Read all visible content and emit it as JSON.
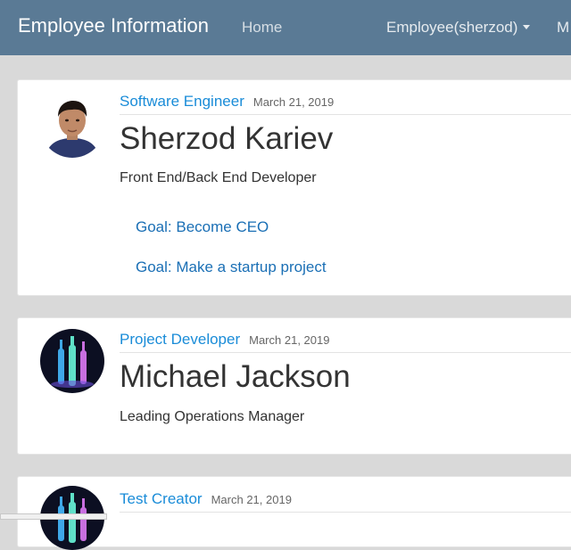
{
  "navbar": {
    "brand": "Employee Information",
    "home": "Home",
    "user_menu": "Employee(sherzod)",
    "more": "M"
  },
  "employees": [
    {
      "role": "Software Engineer",
      "date": "March 21, 2019",
      "name": "Sherzod Kariev",
      "title": "Front End/Back End Developer",
      "goals": [
        "Goal: Become CEO",
        "Goal: Make a startup project"
      ]
    },
    {
      "role": "Project Developer",
      "date": "March 21, 2019",
      "name": "Michael Jackson",
      "title": "Leading Operations Manager",
      "goals": []
    },
    {
      "role": "Test Creator",
      "date": "March 21, 2019"
    }
  ],
  "colors": {
    "navbar": "#5a7a95",
    "link": "#1a8cd8",
    "page_bg": "#d9d9d9"
  }
}
